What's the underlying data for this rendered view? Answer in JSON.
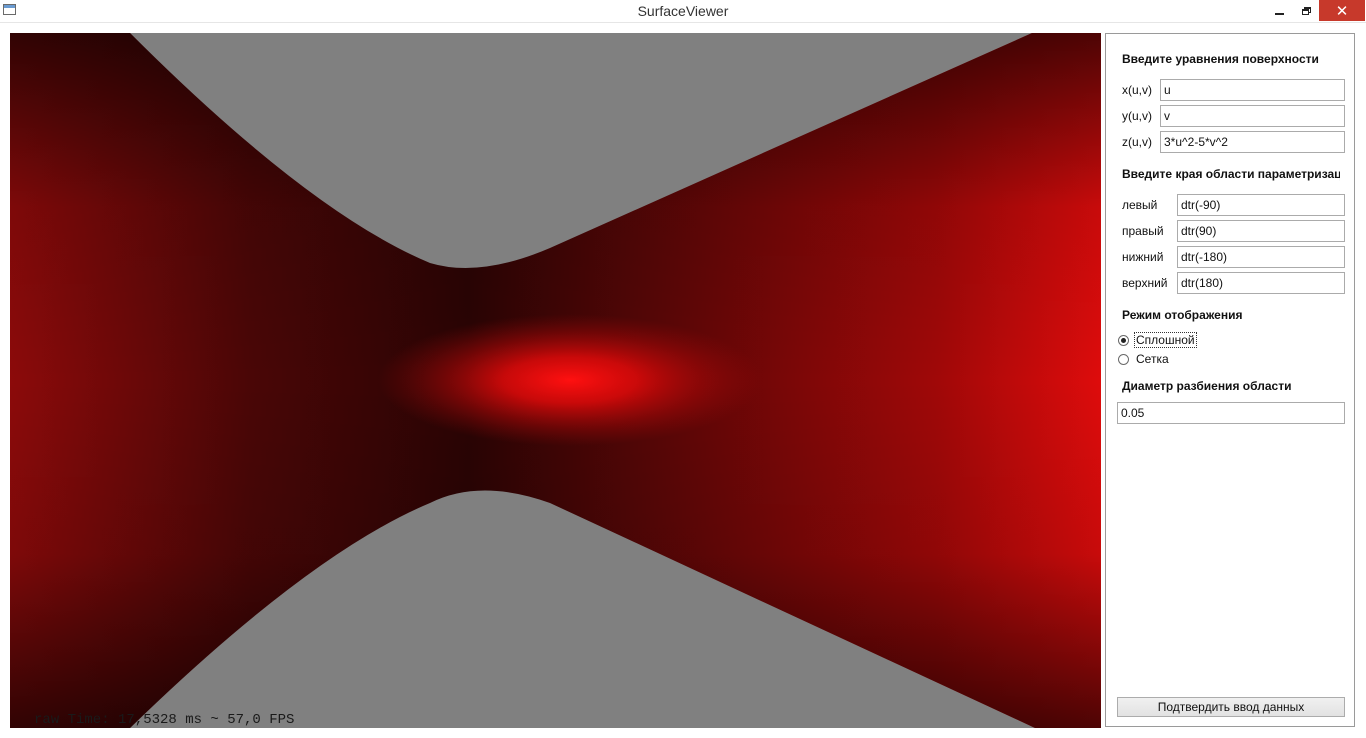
{
  "window": {
    "title": "SurfaceViewer",
    "close_glyph": "✕"
  },
  "viewport": {
    "fps_text": "raw Time: 17,5328 ms ~ 57,0 FPS",
    "background_color": "#808080",
    "surface_color": "#e00a0a"
  },
  "panel": {
    "equations_heading": "Введите уравнения поверхности",
    "x_label": "x(u,v)",
    "x_value": "u",
    "y_label": "y(u,v)",
    "y_value": "v",
    "z_label": "z(u,v)",
    "z_value": "3*u^2-5*v^2",
    "bounds_heading": "Введите края области параметризации",
    "left_label": "левый",
    "left_value": "dtr(-90)",
    "right_label": "правый",
    "right_value": "dtr(90)",
    "bottom_label": "нижний",
    "bottom_value": "dtr(-180)",
    "top_label": "верхний",
    "top_value": "dtr(180)",
    "mode_heading": "Режим отображения",
    "mode_solid": "Сплошной",
    "mode_grid": "Сетка",
    "mode_selected": "Сплошной",
    "diameter_heading": "Диаметр разбиения области",
    "diameter_value": "0.05",
    "submit_label": "Подтвердить ввод данных"
  }
}
